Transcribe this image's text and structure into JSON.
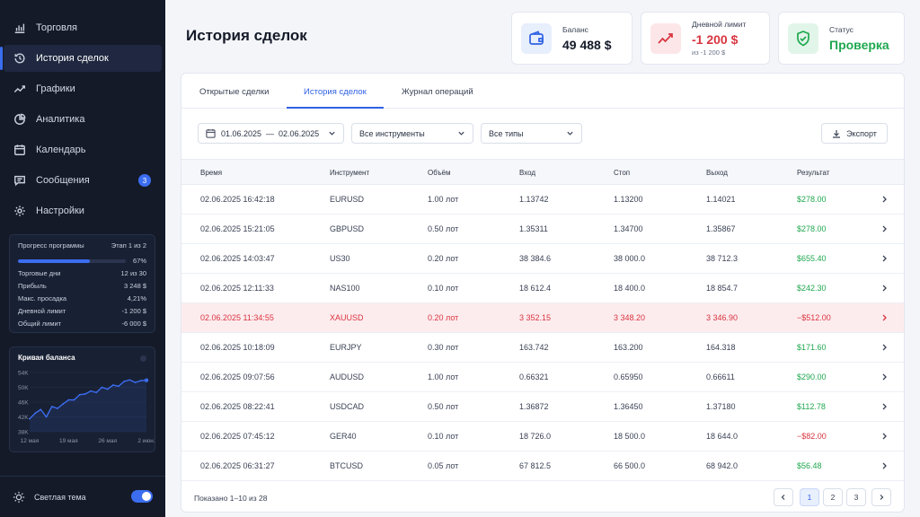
{
  "sidebar": {
    "nav": [
      {
        "label": "Торговля",
        "icon": "bar-chart-icon"
      },
      {
        "label": "История сделок",
        "icon": "history-icon"
      },
      {
        "label": "Графики",
        "icon": "trend-line-icon"
      },
      {
        "label": "Аналитика",
        "icon": "pie-chart-icon"
      },
      {
        "label": "Календарь",
        "icon": "calendar-icon"
      },
      {
        "label": "Сообщения",
        "icon": "message-icon",
        "badge": "3"
      },
      {
        "label": "Настройки",
        "icon": "gear-icon"
      }
    ],
    "progress": {
      "title": "Прогресс программы",
      "stage": "Этап 1 из 2",
      "percent_label": "67%",
      "percent": 67,
      "rows": [
        {
          "label": "Торговые дни",
          "value": "12 из 30"
        },
        {
          "label": "Прибыль",
          "value": "3 248 $"
        },
        {
          "label": "Макс. просадка",
          "value": "4,21%"
        },
        {
          "label": "Дневной лимит",
          "value": "-1 200 $"
        },
        {
          "label": "Общий лимит",
          "value": "-6 000 $"
        }
      ]
    },
    "balance_curve": {
      "title": "Кривая баланса"
    },
    "theme": {
      "label": "Светлая тема",
      "enabled": true
    }
  },
  "chart_data": {
    "type": "line",
    "title": "Кривая баланса",
    "y_ticks": [
      "54K",
      "50K",
      "46K",
      "42K",
      "38K"
    ],
    "x_ticks": [
      "12 мая",
      "19 мая",
      "26 мая",
      "2 июн."
    ],
    "ylim": [
      38000,
      54000
    ],
    "x": [
      0,
      1,
      2,
      3,
      4,
      5,
      6,
      7,
      8,
      9,
      10,
      11,
      12,
      13,
      14,
      15,
      16,
      17,
      18,
      19,
      20,
      21
    ],
    "values": [
      41500,
      43000,
      44000,
      42000,
      44800,
      44300,
      45500,
      46600,
      46600,
      48000,
      48200,
      49000,
      48600,
      50000,
      49500,
      50600,
      50300,
      51600,
      52000,
      51300,
      51800,
      51900
    ],
    "grid": true,
    "color": "#3b6df0"
  },
  "header": {
    "title": "История сделок",
    "cards": [
      {
        "label": "Баланс",
        "value": "49 488 $",
        "icon": "wallet-icon"
      },
      {
        "label": "Дневной лимит",
        "value": "-1 200 $",
        "sub": "из -1 200 $",
        "icon": "trend-down-icon"
      },
      {
        "label": "Статус",
        "value": "Проверка",
        "icon": "shield-check-icon"
      }
    ]
  },
  "tabs": [
    "Открытые сделки",
    "История сделок",
    "Журнал операций"
  ],
  "filters": {
    "date_range": "01.06.2025  —  02.06.2025",
    "instrument": "Все инструменты",
    "type": "Все типы",
    "export": "Экспорт"
  },
  "table": {
    "columns": [
      "Время",
      "Инструмент",
      "Объём",
      "Вход",
      "Стоп",
      "Выход",
      "Результат"
    ],
    "rows": [
      {
        "time": "02.06.2025 16:42:18",
        "instrument": "EURUSD",
        "volume": "1.00 лот",
        "entry": "1.13742",
        "stop": "1.13200",
        "exit": "1.14021",
        "result": "$278.00",
        "loss": false
      },
      {
        "time": "02.06.2025 15:21:05",
        "instrument": "GBPUSD",
        "volume": "0.50 лот",
        "entry": "1.35311",
        "stop": "1.34700",
        "exit": "1.35867",
        "result": "$278.00",
        "loss": false
      },
      {
        "time": "02.06.2025 14:03:47",
        "instrument": "US30",
        "volume": "0.20 лот",
        "entry": "38 384.6",
        "stop": "38 000.0",
        "exit": "38 712.3",
        "result": "$655.40",
        "loss": false
      },
      {
        "time": "02.06.2025 12:11:33",
        "instrument": "NAS100",
        "volume": "0.10 лот",
        "entry": "18 612.4",
        "stop": "18 400.0",
        "exit": "18 854.7",
        "result": "$242.30",
        "loss": false
      },
      {
        "time": "02.06.2025 11:34:55",
        "instrument": "XAUUSD",
        "volume": "0.20 лот",
        "entry": "3 352.15",
        "stop": "3 348.20",
        "exit": "3 346.90",
        "result": "−$512.00",
        "loss": true
      },
      {
        "time": "02.06.2025 10:18:09",
        "instrument": "EURJPY",
        "volume": "0.30 лот",
        "entry": "163.742",
        "stop": "163.200",
        "exit": "164.318",
        "result": "$171.60",
        "loss": false
      },
      {
        "time": "02.06.2025 09:07:56",
        "instrument": "AUDUSD",
        "volume": "1.00 лот",
        "entry": "0.66321",
        "stop": "0.65950",
        "exit": "0.66611",
        "result": "$290.00",
        "loss": false
      },
      {
        "time": "02.06.2025 08:22:41",
        "instrument": "USDCAD",
        "volume": "0.50 лот",
        "entry": "1.36872",
        "stop": "1.36450",
        "exit": "1.37180",
        "result": "$112.78",
        "loss": false
      },
      {
        "time": "02.06.2025 07:45:12",
        "instrument": "GER40",
        "volume": "0.10 лот",
        "entry": "18 726.0",
        "stop": "18 500.0",
        "exit": "18 644.0",
        "result": "−$82.00",
        "loss": true,
        "highlight": false
      },
      {
        "time": "02.06.2025 06:31:27",
        "instrument": "BTCUSD",
        "volume": "0.05 лот",
        "entry": "67 812.5",
        "stop": "66 500.0",
        "exit": "68 942.0",
        "result": "$56.48",
        "loss": false
      }
    ],
    "footer": "Показано 1–10 из 28",
    "pages": [
      "1",
      "2",
      "3"
    ],
    "current_page": "1"
  },
  "colors": {
    "accent": "#2f62e3",
    "profit": "#1fa84f",
    "loss": "#d8343f",
    "sidebar_bg": "#141a28"
  }
}
